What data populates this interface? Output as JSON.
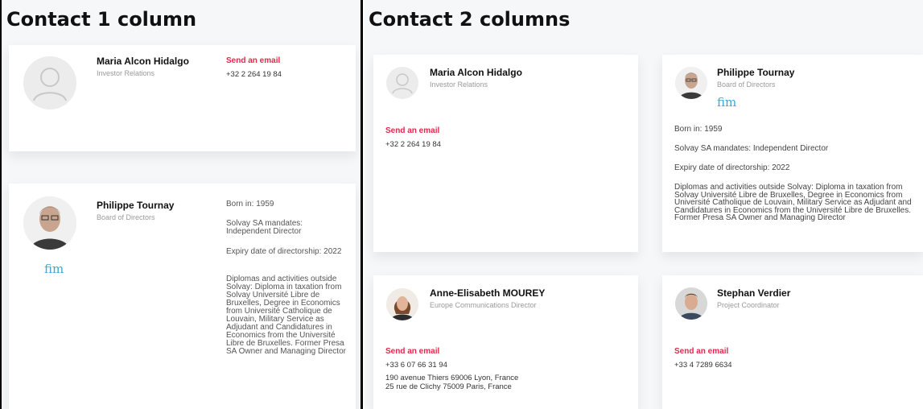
{
  "left_panel": {
    "title": "Contact 1 column",
    "card1": {
      "name": "Maria Alcon Hidalgo",
      "role": "Investor Relations",
      "email_label": "Send an email",
      "phone": "+32 2 264 19 84"
    },
    "card2": {
      "name": "Philippe Tournay",
      "role": "Board of Directors",
      "logo_text": "fim",
      "born": "Born in: 1959",
      "mandates": "Solvay SA mandates: Independent Director",
      "expiry": "Expiry date of directorship: 2022",
      "diplomas": "Diplomas and activities outside Solvay: Diploma in taxation from Solvay Université Libre de Bruxelles, Degree in Economics from Université Catholique de Louvain, Military Service as Adjudant and Candidatures in Economics from the Université Libre de Bruxelles. Former Presa SA Owner and Managing Director"
    }
  },
  "right_panel": {
    "title": "Contact 2 columns",
    "card1": {
      "name": "Maria Alcon Hidalgo",
      "role": "Investor Relations",
      "email_label": "Send an email",
      "phone": "+32 2 264 19 84"
    },
    "card2": {
      "name": "Philippe Tournay",
      "role": "Board of Directors",
      "logo_text": "fim",
      "born": "Born in: 1959",
      "mandates": "Solvay SA mandates: Independent Director",
      "expiry": "Expiry date of directorship: 2022",
      "diplomas": "Diplomas and activities outside Solvay: Diploma in taxation from Solvay Université Libre de Bruxelles, Degree in Economics from Université Catholique de Louvain, Military Service as Adjudant and Candidatures in Economics from the Université Libre de Bruxelles. Former Presa SA Owner and Managing Director"
    },
    "card3": {
      "name": "Anne-Elisabeth MOUREY",
      "role": "Europe Communications Director",
      "email_label": "Send an email",
      "phone": "+33 6 07 66 31 94",
      "address1": "190 avenue Thiers 69006 Lyon, France",
      "address2": "25 rue de Clichy 75009 Paris, France"
    },
    "card4": {
      "name": "Stephan Verdier",
      "role": "Project Coordinator",
      "email_label": "Send an email",
      "phone": "+33 4 7289 6634"
    }
  },
  "colors": {
    "accent": "#e0294a",
    "logo": "#3aa7d8"
  }
}
